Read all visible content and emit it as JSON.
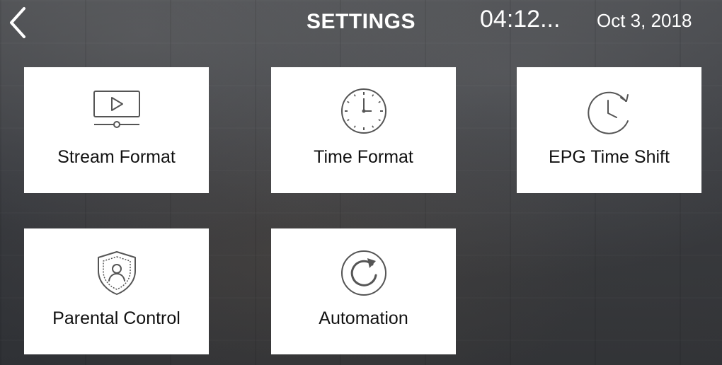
{
  "header": {
    "title": "SETTINGS",
    "time": "04:12...",
    "date": "Oct 3, 2018",
    "back_icon": "chevron-left-icon"
  },
  "tiles": [
    {
      "label": "Stream Format",
      "icon": "video-player-icon"
    },
    {
      "label": "Time Format",
      "icon": "clock-icon"
    },
    {
      "label": "EPG Time Shift",
      "icon": "clock-rewind-icon"
    },
    {
      "label": "Parental Control",
      "icon": "shield-user-icon"
    },
    {
      "label": "Automation",
      "icon": "refresh-icon"
    }
  ],
  "colors": {
    "tile_background": "#ffffff",
    "icon_stroke": "#555555",
    "header_text": "#ffffff"
  }
}
